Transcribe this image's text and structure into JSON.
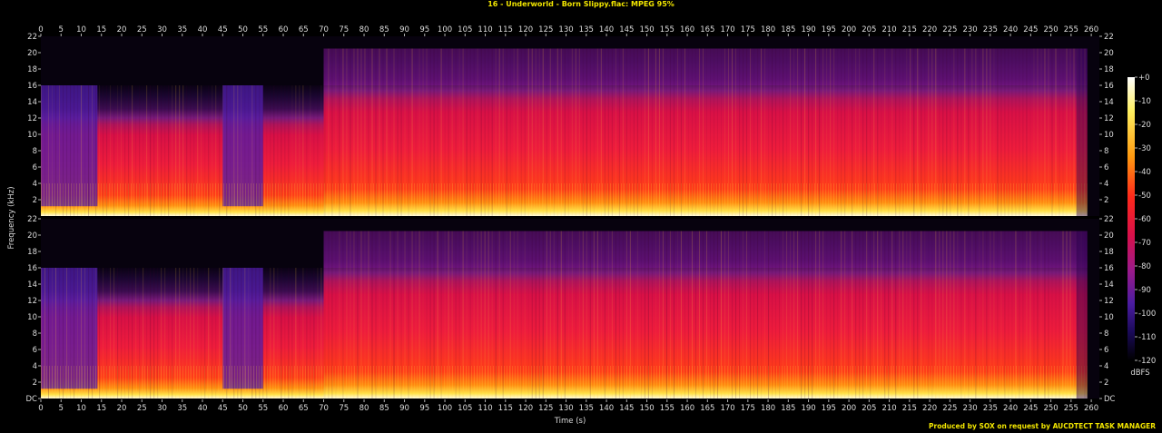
{
  "title": "16 - Underworld - Born Slippy.flac: MPEG 95%",
  "credit": "Produced by SOX on request by AUCDTECT TASK MANAGER",
  "colors": {
    "title": "#f2e600",
    "background": "#000000",
    "axis_text": "#dcdcdc"
  },
  "chart_data": {
    "type": "heatmap",
    "subtype": "spectrogram",
    "channels": 2,
    "xlabel": "Time (s)",
    "ylabel": "Frequency (kHz)",
    "xlim": [
      0,
      262
    ],
    "ylim": [
      0,
      22
    ],
    "x_ticks": [
      0,
      5,
      10,
      15,
      20,
      25,
      30,
      35,
      40,
      45,
      50,
      55,
      60,
      65,
      70,
      75,
      80,
      85,
      90,
      95,
      100,
      105,
      110,
      115,
      120,
      125,
      130,
      135,
      140,
      145,
      150,
      155,
      160,
      165,
      170,
      175,
      180,
      185,
      190,
      195,
      200,
      205,
      210,
      215,
      220,
      225,
      230,
      235,
      240,
      245,
      250,
      255,
      260
    ],
    "y_ticks_top": [
      "22",
      "20",
      "18",
      "16",
      "14",
      "12",
      "10",
      "8",
      "6",
      "4",
      "2"
    ],
    "y_ticks_bottom": [
      "22",
      "20",
      "18",
      "16",
      "14",
      "12",
      "10",
      "8",
      "6",
      "4",
      "2",
      "DC"
    ],
    "y_tick_values": [
      22,
      20,
      18,
      16,
      14,
      12,
      10,
      8,
      6,
      4,
      2,
      0
    ],
    "colorbar": {
      "label": "dBFS",
      "ticks": [
        "+0",
        "-10",
        "-20",
        "-30",
        "-40",
        "-50",
        "-60",
        "-70",
        "-80",
        "-90",
        "-100",
        "-110",
        "-120"
      ],
      "range": [
        -120,
        0
      ]
    },
    "observations": {
      "lowpass_cutoff_khz_before_70s": 16,
      "upper_band_khz_after_70s": 20.5,
      "track_end_s": 259,
      "quiet_sections_s": [
        [
          0,
          14
        ],
        [
          45,
          55
        ]
      ],
      "low_freq_energy_khz": 4
    }
  }
}
